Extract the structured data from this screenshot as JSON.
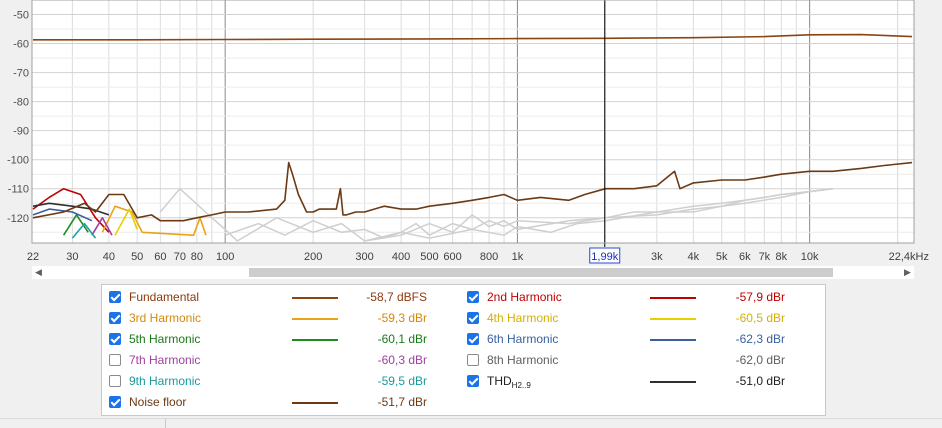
{
  "chart_data": {
    "type": "line",
    "x_scale": "log",
    "xlim": [
      22,
      22400
    ],
    "ylim": [
      -128,
      -45
    ],
    "y_ticks": [
      -50,
      -60,
      -70,
      -80,
      -90,
      -100,
      -110,
      -120
    ],
    "y_tick_labels": [
      "-50",
      "-60",
      "-70",
      "-80",
      "-90",
      "-100",
      "-110",
      "-120"
    ],
    "x_ticks": [
      22,
      30,
      40,
      50,
      60,
      70,
      80,
      100,
      200,
      300,
      400,
      500,
      600,
      800,
      1000,
      2000,
      3000,
      4000,
      5000,
      6000,
      7000,
      8000,
      10000,
      22400
    ],
    "x_tick_labels": [
      "22",
      "30",
      "40",
      "50",
      "60",
      "70",
      "80",
      "100",
      "200",
      "300",
      "400",
      "500",
      "600",
      "800",
      "1k",
      "",
      "3k",
      "4k",
      "5k",
      "6k",
      "7k",
      "8k",
      "10k",
      "22,4kHz"
    ],
    "cursor": {
      "x": 1990,
      "label": "1,99k"
    },
    "grid": true,
    "series": [
      {
        "name": "Fundamental",
        "color": "#8b4513",
        "x": [
          22,
          50,
          100,
          200,
          500,
          1000,
          2000,
          4000,
          7000,
          10000,
          15000,
          22400
        ],
        "y": [
          -58.7,
          -58.7,
          -58.6,
          -58.5,
          -58.4,
          -58.3,
          -58.2,
          -58.0,
          -57.6,
          -57.0,
          -56.9,
          -57.6
        ]
      },
      {
        "name": "Noise floor",
        "color": "#6b3a14",
        "x": [
          22,
          28,
          33,
          36,
          40,
          45,
          50,
          56,
          60,
          65,
          72,
          80,
          90,
          100,
          120,
          150,
          160,
          165,
          170,
          178,
          190,
          200,
          210,
          240,
          248,
          253,
          260,
          280,
          300,
          350,
          400,
          450,
          500,
          600,
          700,
          800,
          900,
          1000,
          1200,
          1500,
          1700,
          2000,
          2500,
          3000,
          3450,
          3600,
          4000,
          5000,
          6000,
          7000,
          8000,
          10000,
          12000,
          15000,
          18000,
          22400
        ],
        "y": [
          -120,
          -118,
          -115,
          -118,
          -112,
          -112,
          -120,
          -119,
          -121,
          -121,
          -121,
          -120,
          -119,
          -118,
          -118,
          -117,
          -114,
          -101,
          -105,
          -112,
          -118,
          -118,
          -117,
          -117,
          -110,
          -119,
          -119,
          -118,
          -118,
          -116,
          -117,
          -117,
          -116,
          -115,
          -114,
          -113,
          -112,
          -114,
          -113,
          -114,
          -112,
          -110,
          -110,
          -109,
          -104,
          -110,
          -108,
          -107,
          -107,
          -106,
          -105,
          -104,
          -104,
          -103,
          -102,
          -101
        ]
      },
      {
        "name": "2nd Harmonic",
        "color": "#c00000",
        "x": [
          22,
          25,
          28,
          32,
          36,
          40
        ],
        "y": [
          -117,
          -113,
          -110,
          -112,
          -120,
          -125
        ]
      },
      {
        "name": "3rd Harmonic",
        "color": "#e8a317",
        "x": [
          38,
          42,
          48,
          52,
          78,
          82,
          86
        ],
        "y": [
          -125,
          -116,
          -118,
          -125,
          -126,
          -120,
          -126
        ]
      },
      {
        "name": "4th Harmonic",
        "color": "#e6d000",
        "x": [
          42,
          47,
          50
        ],
        "y": [
          -126,
          -117,
          -124
        ]
      },
      {
        "name": "5th Harmonic",
        "color": "#1e8c1e",
        "x": [
          28,
          31,
          34
        ],
        "y": [
          -126,
          -119,
          -125
        ]
      },
      {
        "name": "6th Harmonic",
        "color": "#3a5fa0",
        "x": [
          22,
          25,
          30,
          35
        ],
        "y": [
          -119,
          -117,
          -118,
          -121
        ]
      },
      {
        "name": "7th Harmonic",
        "color": "#a040a0",
        "x": [
          35,
          38,
          41
        ],
        "y": [
          -126,
          -120,
          -126
        ]
      },
      {
        "name": "9th Harmonic",
        "color": "#20a0a0",
        "x": [
          30,
          33,
          36
        ],
        "y": [
          -127,
          -122,
          -127
        ]
      },
      {
        "name": "THD H2..9",
        "color": "#303030",
        "x": [
          22,
          25,
          30,
          35,
          40
        ],
        "y": [
          -116,
          -115,
          -116,
          -117,
          -119
        ]
      }
    ],
    "gray_traces": [
      {
        "x": [
          60,
          70,
          90,
          100,
          110,
          150,
          200,
          250,
          300,
          400,
          500,
          600,
          700,
          800,
          900,
          1000,
          1500,
          2000,
          2500,
          3000,
          4000,
          5000,
          6000,
          7000,
          8000,
          10000,
          12000
        ],
        "y": [
          -118,
          -110,
          -120,
          -124,
          -128,
          -120,
          -125,
          -122,
          -128,
          -126,
          -122,
          -125,
          -119,
          -123,
          -121,
          -124,
          -121,
          -120,
          -118,
          -118,
          -116,
          -115,
          -114,
          -113,
          -112,
          -111,
          -110
        ]
      },
      {
        "x": [
          100,
          130,
          160,
          200,
          250,
          300,
          350,
          400,
          450,
          500,
          600,
          700,
          800,
          900,
          1000,
          1500,
          2000,
          3000,
          4000,
          5000,
          6000,
          7000,
          8000,
          10000,
          12000
        ],
        "y": [
          -126,
          -122,
          -126,
          -121,
          -125,
          -124,
          -127,
          -125,
          -122,
          -126,
          -122,
          -124,
          -121,
          -123,
          -121,
          -122,
          -120,
          -119,
          -117,
          -116,
          -114,
          -113,
          -112,
          -111,
          -110
        ]
      },
      {
        "x": [
          300,
          400,
          500,
          700,
          900,
          1000,
          1300,
          1600,
          2000,
          3000,
          4000,
          5000,
          6000,
          8000,
          10000,
          12000
        ],
        "y": [
          -128,
          -125,
          -127,
          -124,
          -126,
          -123,
          -125,
          -122,
          -121,
          -118,
          -118,
          -116,
          -115,
          -113,
          -111,
          -110
        ]
      }
    ]
  },
  "legend": {
    "left": [
      {
        "label": "Fundamental",
        "value": "-58,7 dBFS",
        "color": "#8b4513",
        "text_color": "#8b3a0e",
        "checked": true
      },
      {
        "label": "3rd Harmonic",
        "value": "-59,3 dBr",
        "color": "#e8a317",
        "text_color": "#d4890a",
        "checked": true
      },
      {
        "label": "5th Harmonic",
        "value": "-60,1 dBr",
        "color": "#1e8c1e",
        "text_color": "#1a7a1a",
        "checked": true
      },
      {
        "label": "7th Harmonic",
        "value": "-60,3 dBr",
        "color": "",
        "text_color": "#a040a0",
        "checked": false
      },
      {
        "label": "9th Harmonic",
        "value": "-59,5 dBr",
        "color": "",
        "text_color": "#1a9a9a",
        "checked": false
      },
      {
        "label": "Noise floor",
        "value": "-51,7 dBr",
        "color": "#6b3a14",
        "text_color": "#6b3a14",
        "checked": true
      }
    ],
    "right": [
      {
        "label": "2nd Harmonic",
        "value": "-57,9 dBr",
        "color": "#c00000",
        "text_color": "#c00000",
        "checked": true
      },
      {
        "label": "4th Harmonic",
        "value": "-60,5 dBr",
        "color": "#e6d000",
        "text_color": "#d4b000",
        "checked": true
      },
      {
        "label": "6th Harmonic",
        "value": "-62,3 dBr",
        "color": "#3a5fa0",
        "text_color": "#3a5fa0",
        "checked": true
      },
      {
        "label": "8th Harmonic",
        "value": "-62,0 dBr",
        "color": "",
        "text_color": "#606060",
        "checked": false
      },
      {
        "label": "THD",
        "sub": "H2..9",
        "value": "-51,0 dBr",
        "color": "#303030",
        "text_color": "#202020",
        "checked": true
      }
    ]
  }
}
